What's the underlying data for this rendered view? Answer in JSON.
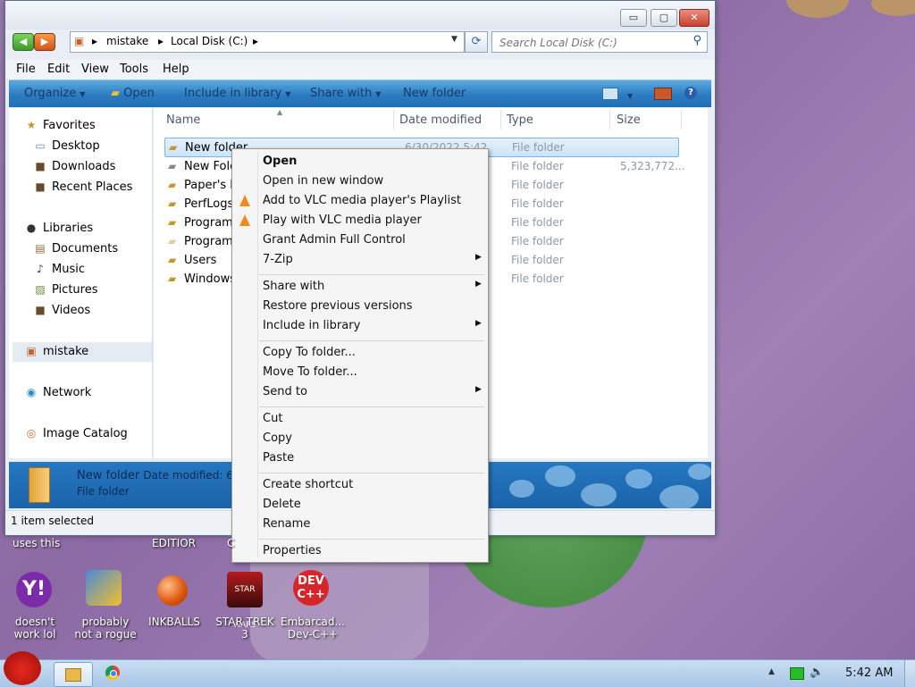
{
  "window": {
    "controls": {
      "minimize": "▭",
      "maximize": "▢",
      "close": "✕"
    },
    "breadcrumbs": [
      "mistake",
      "Local Disk (C:)"
    ],
    "search_placeholder": "Search Local Disk (C:)",
    "menu": [
      "File",
      "Edit",
      "View",
      "Tools",
      "Help"
    ],
    "commands": [
      {
        "label": "Organize",
        "has_arrow": true
      },
      {
        "label": "Open",
        "has_arrow": false
      },
      {
        "label": "Include in library",
        "has_arrow": true
      },
      {
        "label": "Share with",
        "has_arrow": true
      },
      {
        "label": "New folder",
        "has_arrow": false
      }
    ],
    "help_label": "?",
    "nav": {
      "favorites": "Favorites",
      "desktop": "Desktop",
      "downloads": "Downloads",
      "recent": "Recent Places",
      "libraries": "Libraries",
      "documents": "Documents",
      "music": "Music",
      "pictures": "Pictures",
      "videos": "Videos",
      "mistake": "mistake",
      "network": "Network",
      "image_catalog": "Image Catalog"
    },
    "columns": [
      "Name",
      "Date modified",
      "Type",
      "Size"
    ],
    "rows": [
      {
        "name": "New folder",
        "date": "6/30/2022 5:42",
        "type": "File folder",
        "size": ""
      },
      {
        "name": "New Folo",
        "date": "",
        "type": "File folder",
        "size": "5,323,772..."
      },
      {
        "name": "Paper's P",
        "date": "",
        "type": "File folder",
        "size": ""
      },
      {
        "name": "PerfLogs",
        "date": "",
        "type": "File folder",
        "size": ""
      },
      {
        "name": "Program",
        "date": "",
        "type": "File folder",
        "size": ""
      },
      {
        "name": "Programl",
        "date": "",
        "type": "File folder",
        "size": ""
      },
      {
        "name": "Users",
        "date": "",
        "type": "File folder",
        "size": ""
      },
      {
        "name": "Windows",
        "date": "",
        "type": "File folder",
        "size": ""
      }
    ],
    "details": {
      "name": "New folder",
      "date_label": "Date modified: 6/",
      "type": "File folder"
    },
    "status": "1 item selected"
  },
  "context_menu": {
    "open": "Open",
    "open_new_window": "Open in new window",
    "vlc_playlist": "Add to VLC media player's Playlist",
    "vlc_play": "Play with VLC media player",
    "grant_admin": "Grant Admin Full Control",
    "sevenzip": "7-Zip",
    "share_with": "Share with",
    "restore": "Restore previous versions",
    "include_library": "Include in library",
    "copy_to": "Copy To folder...",
    "move_to": "Move To folder...",
    "send_to": "Send to",
    "cut": "Cut",
    "copy": "Copy",
    "paste": "Paste",
    "create_shortcut": "Create shortcut",
    "delete": "Delete",
    "rename": "Rename",
    "properties": "Properties"
  },
  "desktop": {
    "partial_labels": [
      "uses this",
      "EDITIOR",
      "C"
    ],
    "icons": [
      {
        "line1": "doesn't",
        "line2": "work lol",
        "glyph": "Y!"
      },
      {
        "line1": "probably",
        "line2": "not a rogue",
        "glyph": ""
      },
      {
        "line1": "INKBALLS",
        "line2": "",
        "glyph": ""
      },
      {
        "line1": "STAR TREK",
        "line2": "3",
        "glyph": "STAR WARS"
      },
      {
        "line1": "Embarcad...",
        "line2": "Dev-C++",
        "glyph": "DEV C++"
      }
    ]
  },
  "taskbar": {
    "clock": "5:42 AM"
  },
  "colors": {
    "command_bar": "#2c7bc0",
    "selection": "#cce4f7",
    "close_button": "#c8402c"
  }
}
